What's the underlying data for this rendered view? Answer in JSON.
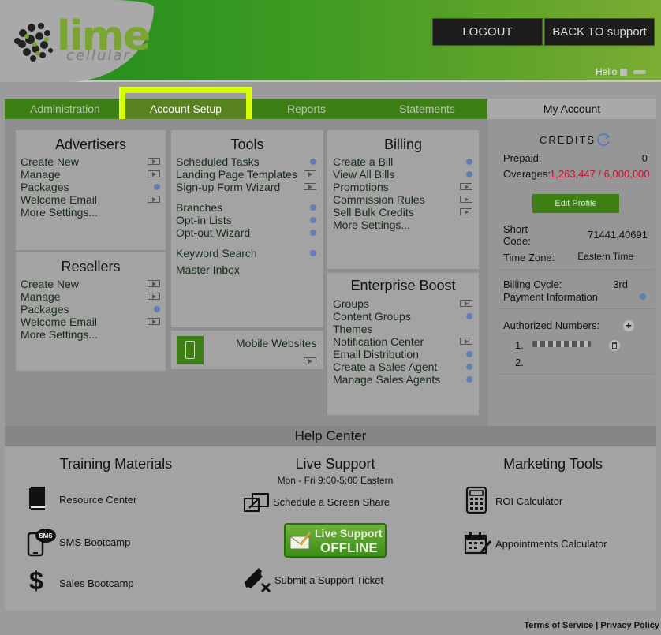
{
  "header": {
    "logo_word": "lime",
    "logo_sub": "cellular",
    "logout_label": "LOGOUT",
    "back_label": "BACK TO support",
    "hello_label": "Hello"
  },
  "tabs": [
    {
      "label": "Administration",
      "active": false
    },
    {
      "label": "Account Setup",
      "active": true
    },
    {
      "label": "Reports",
      "active": false
    },
    {
      "label": "Statements",
      "active": false
    }
  ],
  "advertisers": {
    "title": "Advertisers",
    "items": [
      {
        "label": "Create New",
        "icon": "video"
      },
      {
        "label": "Manage",
        "icon": "video"
      },
      {
        "label": "Packages",
        "icon": "dot"
      },
      {
        "label": "Welcome Email",
        "icon": "video"
      },
      {
        "label": "More Settings...",
        "icon": ""
      }
    ]
  },
  "resellers": {
    "title": "Resellers",
    "items": [
      {
        "label": "Create New",
        "icon": "video"
      },
      {
        "label": "Manage",
        "icon": "video"
      },
      {
        "label": "Packages",
        "icon": "dot"
      },
      {
        "label": "Welcome Email",
        "icon": "video"
      },
      {
        "label": "More Settings...",
        "icon": ""
      }
    ]
  },
  "tools": {
    "title": "Tools",
    "items": [
      {
        "label": "Scheduled Tasks",
        "icon": "dot"
      },
      {
        "label": "Landing Page Templates",
        "icon": "video"
      },
      {
        "label": "Sign-up Form Wizard",
        "icon": "video"
      },
      {
        "label": "Branches",
        "icon": "dot"
      },
      {
        "label": "Opt-in Lists",
        "icon": "dot"
      },
      {
        "label": "Opt-out Wizard",
        "icon": "dot"
      },
      {
        "label": "Keyword Search",
        "icon": "dot"
      },
      {
        "label": "Master Inbox",
        "icon": ""
      }
    ]
  },
  "mobile": {
    "label": "Mobile Websites"
  },
  "billing": {
    "title": "Billing",
    "items": [
      {
        "label": "Create a Bill",
        "icon": "dot"
      },
      {
        "label": "View All Bills",
        "icon": "dot"
      },
      {
        "label": "Promotions",
        "icon": "video"
      },
      {
        "label": "Commission Rules",
        "icon": "video"
      },
      {
        "label": "Sell Bulk Credits",
        "icon": "video"
      },
      {
        "label": "More Settings...",
        "icon": ""
      }
    ]
  },
  "enterprise": {
    "title": "Enterprise Boost",
    "items": [
      {
        "label": "Groups",
        "icon": "video"
      },
      {
        "label": "Content Groups",
        "icon": "dot"
      },
      {
        "label": "Themes",
        "icon": ""
      },
      {
        "label": "Notification Center",
        "icon": "video"
      },
      {
        "label": "Email Distribution",
        "icon": "dot"
      },
      {
        "label": "Create a Sales Agent",
        "icon": "dot"
      },
      {
        "label": "Manage Sales Agents",
        "icon": "dot"
      }
    ]
  },
  "account": {
    "title": "My Account",
    "credits_label": "CREDITS",
    "prepaid_label": "Prepaid:",
    "prepaid_value": "0",
    "overages_label": "Overages:",
    "overages_value": "1,263,447 / 6,000,000",
    "overages_color": "#c8102e",
    "edit_profile_label": "Edit Profile",
    "short_code_label": "Short Code:",
    "short_code_value": "71441,40691",
    "time_zone_label": "Time Zone:",
    "time_zone_value": "Eastern Time",
    "billing_cycle_label": "Billing Cycle:",
    "billing_cycle_value": "3rd",
    "payment_info_label": "Payment Information",
    "authorized_label": "Authorized Numbers:",
    "authorized": [
      {
        "index": "1."
      },
      {
        "index": "2."
      }
    ]
  },
  "help": {
    "title": "Help Center",
    "training": {
      "title": "Training Materials",
      "items": [
        {
          "label": "Resource Center",
          "icon": "book-icon"
        },
        {
          "label": "SMS Bootcamp",
          "icon": "sms-phone-icon"
        },
        {
          "label": "Sales Bootcamp",
          "icon": "dollar-icon"
        }
      ]
    },
    "live": {
      "title": "Live Support",
      "hours": "Mon - Fri 9:00-5:00 Eastern",
      "screen_share": "Schedule a Screen Share",
      "live_line1": "Live Support",
      "live_line2": "OFFLINE",
      "ticket": "Submit a Support Ticket"
    },
    "marketing": {
      "title": "Marketing Tools",
      "items": [
        {
          "label": "ROI Calculator",
          "icon": "calculator-icon"
        },
        {
          "label": "Appointments Calculator",
          "icon": "calendar-icon"
        }
      ]
    }
  },
  "footer": {
    "terms": "Terms of Service",
    "sep": "|",
    "privacy": "Privacy Policy"
  },
  "colors": {
    "brand_green": "#3d7f14",
    "highlight": "#d4ff00",
    "icon_dot": "#5f7fb3"
  }
}
